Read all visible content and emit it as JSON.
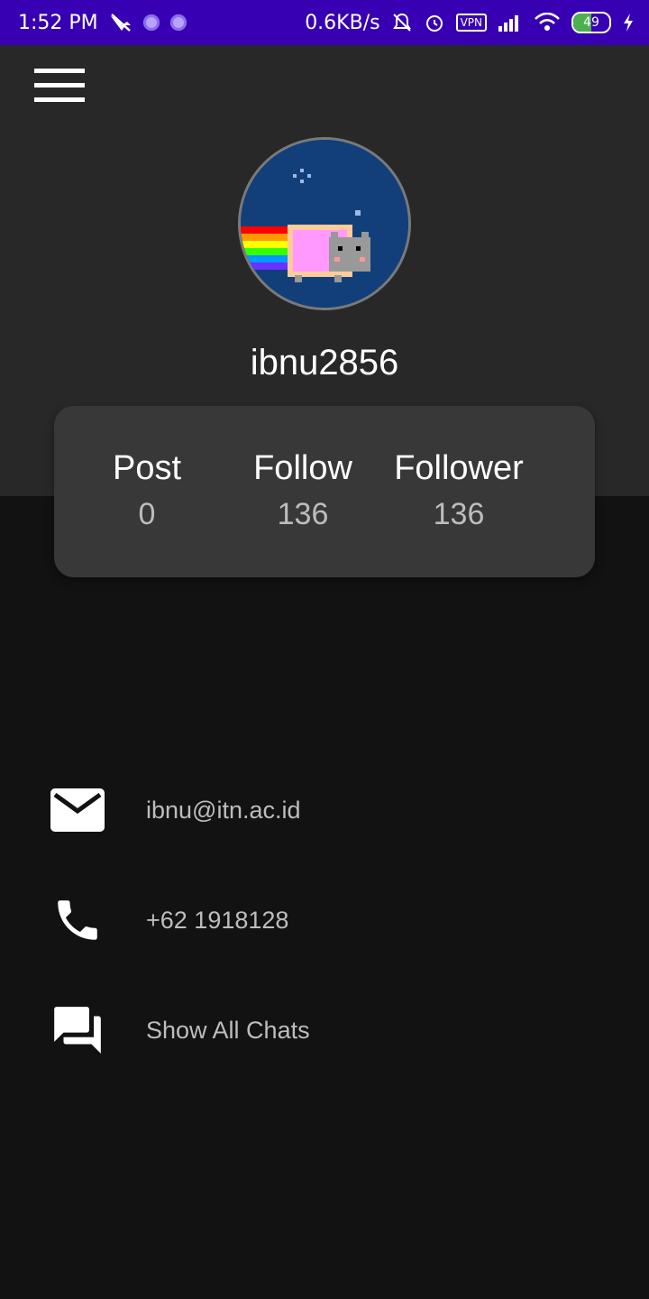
{
  "status_bar": {
    "time": "1:52 PM",
    "network_speed": "0.6KB/s",
    "vpn_label": "VPN",
    "battery": "49",
    "icons": [
      "bird-icon",
      "dot-icon",
      "dot-icon",
      "mute-bell-icon",
      "alarm-icon",
      "vpn-icon",
      "signal-icon",
      "wifi-icon",
      "battery-icon",
      "charging-icon"
    ]
  },
  "header": {
    "menu_icon": "hamburger-menu-icon"
  },
  "profile": {
    "avatar_icon": "nyan-cat-avatar",
    "username": "ibnu2856"
  },
  "stats": [
    {
      "label": "Post",
      "value": "0"
    },
    {
      "label": "Follow",
      "value": "136"
    },
    {
      "label": "Follower",
      "value": "136"
    }
  ],
  "info": {
    "email": {
      "icon": "mail-icon",
      "text": "ibnu@itn.ac.id"
    },
    "phone": {
      "icon": "phone-icon",
      "text": "+62 1918128"
    },
    "chats": {
      "icon": "chat-icon",
      "text": "Show All Chats"
    }
  },
  "colors": {
    "status_bar": "#3700b3",
    "header_bg": "#282828",
    "body_bg": "#121212",
    "card_bg": "#383838",
    "avatar_bg": "#123f7a"
  }
}
